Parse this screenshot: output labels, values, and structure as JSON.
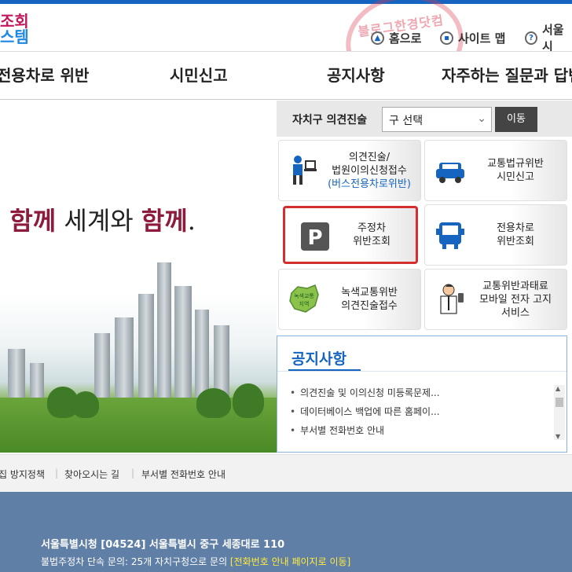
{
  "header": {
    "logo_line1": "조회",
    "logo_line2": "스템",
    "stamp_text": "블로그한경닷컴",
    "util": [
      {
        "label": "홈으로",
        "icon": "home-icon"
      },
      {
        "label": "사이트 맵",
        "icon": "sitemap-icon"
      },
      {
        "label": "서울시",
        "icon": "seoul-icon"
      }
    ]
  },
  "nav": {
    "items": [
      "전용차로 위반",
      "시민신고",
      "공지사항",
      "자주하는 질문과 답변"
    ]
  },
  "hero": {
    "slogan_pre": "· ",
    "slogan_red1": "함께",
    "slogan_mid": " 세계와 ",
    "slogan_red2": "함께",
    "slogan_end": "."
  },
  "district": {
    "label": "자치구 의견진술",
    "select_value": "구 선택",
    "go_label": "이동"
  },
  "tiles": [
    {
      "line1": "의견진술/",
      "line2": "법원이의신청접수",
      "line3": "(버스전용차로위반)",
      "icon": "person-desk-icon"
    },
    {
      "line1": "교통법규위반",
      "line2": "시민신고",
      "line3": "",
      "icon": "car-icon"
    },
    {
      "line1": "주정차",
      "line2": "위반조회",
      "line3": "",
      "icon": "parking-icon"
    },
    {
      "line1": "전용차로",
      "line2": "위반조회",
      "line3": "",
      "icon": "bus-icon"
    },
    {
      "line1": "녹색교통위반",
      "line2": "의견진술접수",
      "line3": "",
      "icon": "green-zone-map-icon",
      "icon_text_top": "녹색교통",
      "icon_text_bottom": "지역"
    },
    {
      "line1": "교통위반과태료",
      "line2": "모바일 전자 고지",
      "line3": "서비스",
      "icon": "mobile-man-icon"
    }
  ],
  "notice": {
    "title": "공지사항",
    "items": [
      "의견진술 및 이의신청 미등록문제...",
      "데이터베이스 백업에 따른 홈페이...",
      "부서별 전화번호 안내"
    ]
  },
  "footlinks": [
    "집 방지정책",
    "찾아오시는 길",
    "부서별 전화번호 안내"
  ],
  "footer": {
    "address": "서울특별시청 [04524] 서울특별시 중구 세종대로 110",
    "inquiry": "불법주정차 단속 문의: 25개 자치구청으로 문의 ",
    "inquiry_link": "[전화번호 안내 페이지로 이동]"
  },
  "colors": {
    "accent_blue": "#1565c0",
    "highlight_red": "#d32f2f",
    "footer_bg": "#5f7fa6",
    "slogan_red": "#8e1b3c"
  }
}
